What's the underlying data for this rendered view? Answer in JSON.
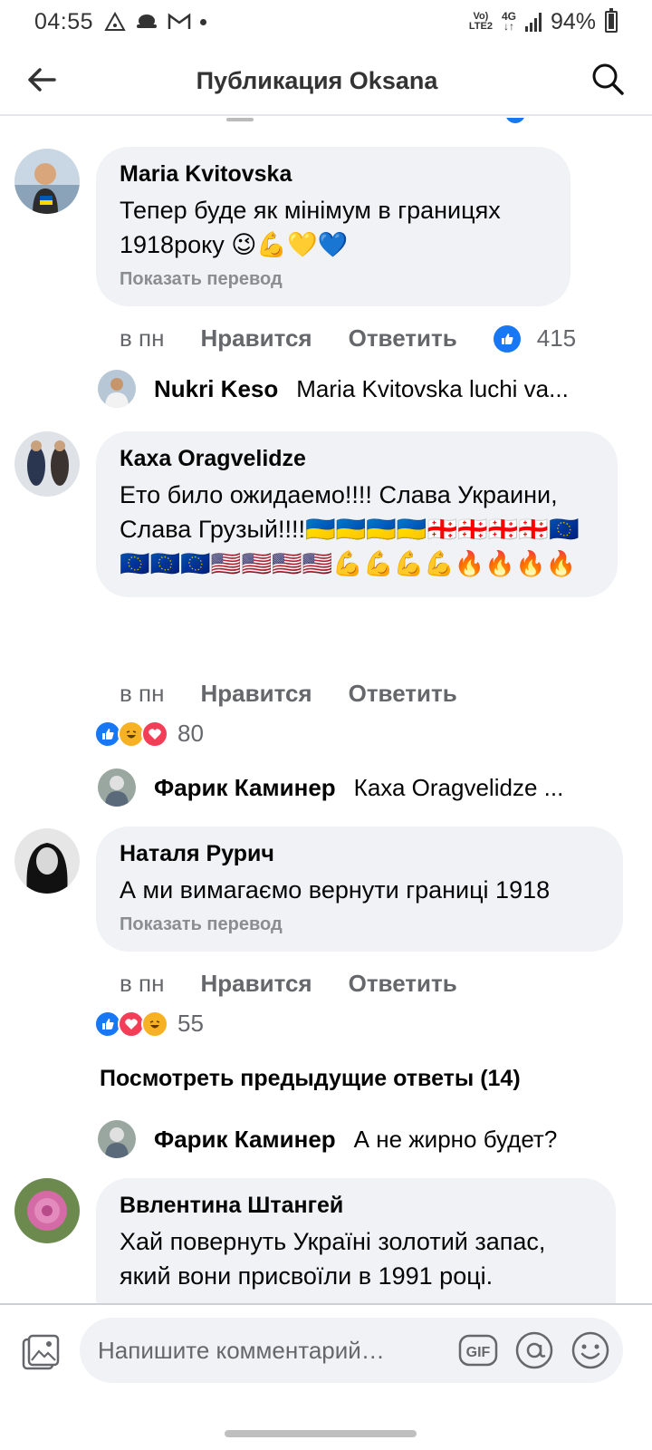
{
  "status_bar": {
    "time": "04:55",
    "network_top": "Vo)",
    "network_bottom": "LTE2",
    "net_gen": "4G",
    "battery": "94%"
  },
  "header": {
    "title": "Публикация Oksana",
    "back_icon": "back-arrow-icon",
    "search_icon": "search-icon"
  },
  "comments": [
    {
      "author": "Maria Kvitovska",
      "text": "Тепер буде як мінімум в границях 1918року 😉💪💛💙",
      "translate": "Показать перевод",
      "time": "в пн",
      "like_label": "Нравится",
      "reply_label": "Ответить",
      "reaction_count": "415",
      "reply_preview": {
        "author": "Nukri Keso",
        "text": "Maria Kvitovska luchi va..."
      }
    },
    {
      "author": "Каха Oragvelidze",
      "text": "Ето било ожидаемо!!!! Слава Украини, Слава Грузый!!!!🇺🇦🇺🇦🇺🇦🇺🇦🇬🇪🇬🇪🇬🇪🇬🇪🇪🇺🇪🇺🇪🇺🇪🇺🇺🇸🇺🇸🇺🇸🇺🇸💪💪💪💪🔥🔥🔥🔥",
      "time": "в пн",
      "like_label": "Нравится",
      "reply_label": "Ответить",
      "reaction_count": "80",
      "reply_preview": {
        "author": "Фарик Каминер",
        "text": "Каха Oragvelidze ..."
      }
    },
    {
      "author": "Наталя Рурич",
      "text": "А ми вимагаємо вернути границі 1918",
      "translate": "Показать перевод",
      "time": "в пн",
      "like_label": "Нравится",
      "reply_label": "Ответить",
      "reaction_count": "55",
      "previous_replies": "Посмотреть предыдущие ответы (14)",
      "reply_preview": {
        "author": "Фарик Каминер",
        "text": "А не жирно будет?"
      }
    },
    {
      "author": "Ввлентина Штангей",
      "text": "Хай повернуть Україні золотий запас, який вони присвоїли в 1991 році."
    }
  ],
  "composer": {
    "placeholder": "Напишите комментарий…",
    "gif_label": "GIF",
    "icons": [
      "photo-icon",
      "gif-icon",
      "mention-icon",
      "emoji-icon"
    ]
  },
  "colors": {
    "accent": "#1877f2",
    "bubble_bg": "#f0f2f5",
    "secondary_text": "#65676b",
    "love": "#f33e58",
    "haha": "#f7b125"
  }
}
